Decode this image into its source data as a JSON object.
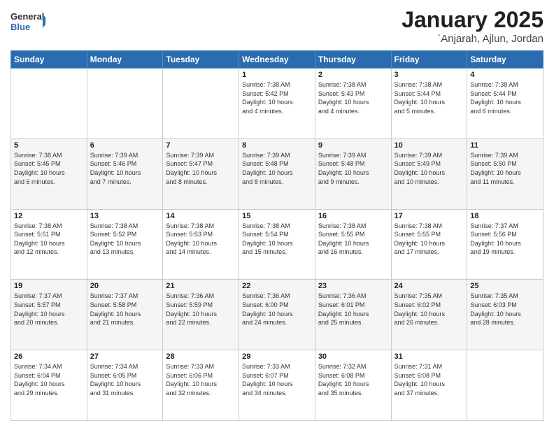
{
  "header": {
    "logo_line1": "General",
    "logo_line2": "Blue",
    "month": "January 2025",
    "location": "`Anjarah, Ajlun, Jordan"
  },
  "weekdays": [
    "Sunday",
    "Monday",
    "Tuesday",
    "Wednesday",
    "Thursday",
    "Friday",
    "Saturday"
  ],
  "weeks": [
    [
      {
        "day": "",
        "info": ""
      },
      {
        "day": "",
        "info": ""
      },
      {
        "day": "",
        "info": ""
      },
      {
        "day": "1",
        "info": "Sunrise: 7:38 AM\nSunset: 5:42 PM\nDaylight: 10 hours\nand 4 minutes."
      },
      {
        "day": "2",
        "info": "Sunrise: 7:38 AM\nSunset: 5:43 PM\nDaylight: 10 hours\nand 4 minutes."
      },
      {
        "day": "3",
        "info": "Sunrise: 7:38 AM\nSunset: 5:44 PM\nDaylight: 10 hours\nand 5 minutes."
      },
      {
        "day": "4",
        "info": "Sunrise: 7:38 AM\nSunset: 5:44 PM\nDaylight: 10 hours\nand 6 minutes."
      }
    ],
    [
      {
        "day": "5",
        "info": "Sunrise: 7:38 AM\nSunset: 5:45 PM\nDaylight: 10 hours\nand 6 minutes."
      },
      {
        "day": "6",
        "info": "Sunrise: 7:39 AM\nSunset: 5:46 PM\nDaylight: 10 hours\nand 7 minutes."
      },
      {
        "day": "7",
        "info": "Sunrise: 7:39 AM\nSunset: 5:47 PM\nDaylight: 10 hours\nand 8 minutes."
      },
      {
        "day": "8",
        "info": "Sunrise: 7:39 AM\nSunset: 5:48 PM\nDaylight: 10 hours\nand 8 minutes."
      },
      {
        "day": "9",
        "info": "Sunrise: 7:39 AM\nSunset: 5:48 PM\nDaylight: 10 hours\nand 9 minutes."
      },
      {
        "day": "10",
        "info": "Sunrise: 7:39 AM\nSunset: 5:49 PM\nDaylight: 10 hours\nand 10 minutes."
      },
      {
        "day": "11",
        "info": "Sunrise: 7:39 AM\nSunset: 5:50 PM\nDaylight: 10 hours\nand 11 minutes."
      }
    ],
    [
      {
        "day": "12",
        "info": "Sunrise: 7:38 AM\nSunset: 5:51 PM\nDaylight: 10 hours\nand 12 minutes."
      },
      {
        "day": "13",
        "info": "Sunrise: 7:38 AM\nSunset: 5:52 PM\nDaylight: 10 hours\nand 13 minutes."
      },
      {
        "day": "14",
        "info": "Sunrise: 7:38 AM\nSunset: 5:53 PM\nDaylight: 10 hours\nand 14 minutes."
      },
      {
        "day": "15",
        "info": "Sunrise: 7:38 AM\nSunset: 5:54 PM\nDaylight: 10 hours\nand 15 minutes."
      },
      {
        "day": "16",
        "info": "Sunrise: 7:38 AM\nSunset: 5:55 PM\nDaylight: 10 hours\nand 16 minutes."
      },
      {
        "day": "17",
        "info": "Sunrise: 7:38 AM\nSunset: 5:55 PM\nDaylight: 10 hours\nand 17 minutes."
      },
      {
        "day": "18",
        "info": "Sunrise: 7:37 AM\nSunset: 5:56 PM\nDaylight: 10 hours\nand 19 minutes."
      }
    ],
    [
      {
        "day": "19",
        "info": "Sunrise: 7:37 AM\nSunset: 5:57 PM\nDaylight: 10 hours\nand 20 minutes."
      },
      {
        "day": "20",
        "info": "Sunrise: 7:37 AM\nSunset: 5:58 PM\nDaylight: 10 hours\nand 21 minutes."
      },
      {
        "day": "21",
        "info": "Sunrise: 7:36 AM\nSunset: 5:59 PM\nDaylight: 10 hours\nand 22 minutes."
      },
      {
        "day": "22",
        "info": "Sunrise: 7:36 AM\nSunset: 6:00 PM\nDaylight: 10 hours\nand 24 minutes."
      },
      {
        "day": "23",
        "info": "Sunrise: 7:36 AM\nSunset: 6:01 PM\nDaylight: 10 hours\nand 25 minutes."
      },
      {
        "day": "24",
        "info": "Sunrise: 7:35 AM\nSunset: 6:02 PM\nDaylight: 10 hours\nand 26 minutes."
      },
      {
        "day": "25",
        "info": "Sunrise: 7:35 AM\nSunset: 6:03 PM\nDaylight: 10 hours\nand 28 minutes."
      }
    ],
    [
      {
        "day": "26",
        "info": "Sunrise: 7:34 AM\nSunset: 6:04 PM\nDaylight: 10 hours\nand 29 minutes."
      },
      {
        "day": "27",
        "info": "Sunrise: 7:34 AM\nSunset: 6:05 PM\nDaylight: 10 hours\nand 31 minutes."
      },
      {
        "day": "28",
        "info": "Sunrise: 7:33 AM\nSunset: 6:06 PM\nDaylight: 10 hours\nand 32 minutes."
      },
      {
        "day": "29",
        "info": "Sunrise: 7:33 AM\nSunset: 6:07 PM\nDaylight: 10 hours\nand 34 minutes."
      },
      {
        "day": "30",
        "info": "Sunrise: 7:32 AM\nSunset: 6:08 PM\nDaylight: 10 hours\nand 35 minutes."
      },
      {
        "day": "31",
        "info": "Sunrise: 7:31 AM\nSunset: 6:08 PM\nDaylight: 10 hours\nand 37 minutes."
      },
      {
        "day": "",
        "info": ""
      }
    ]
  ]
}
